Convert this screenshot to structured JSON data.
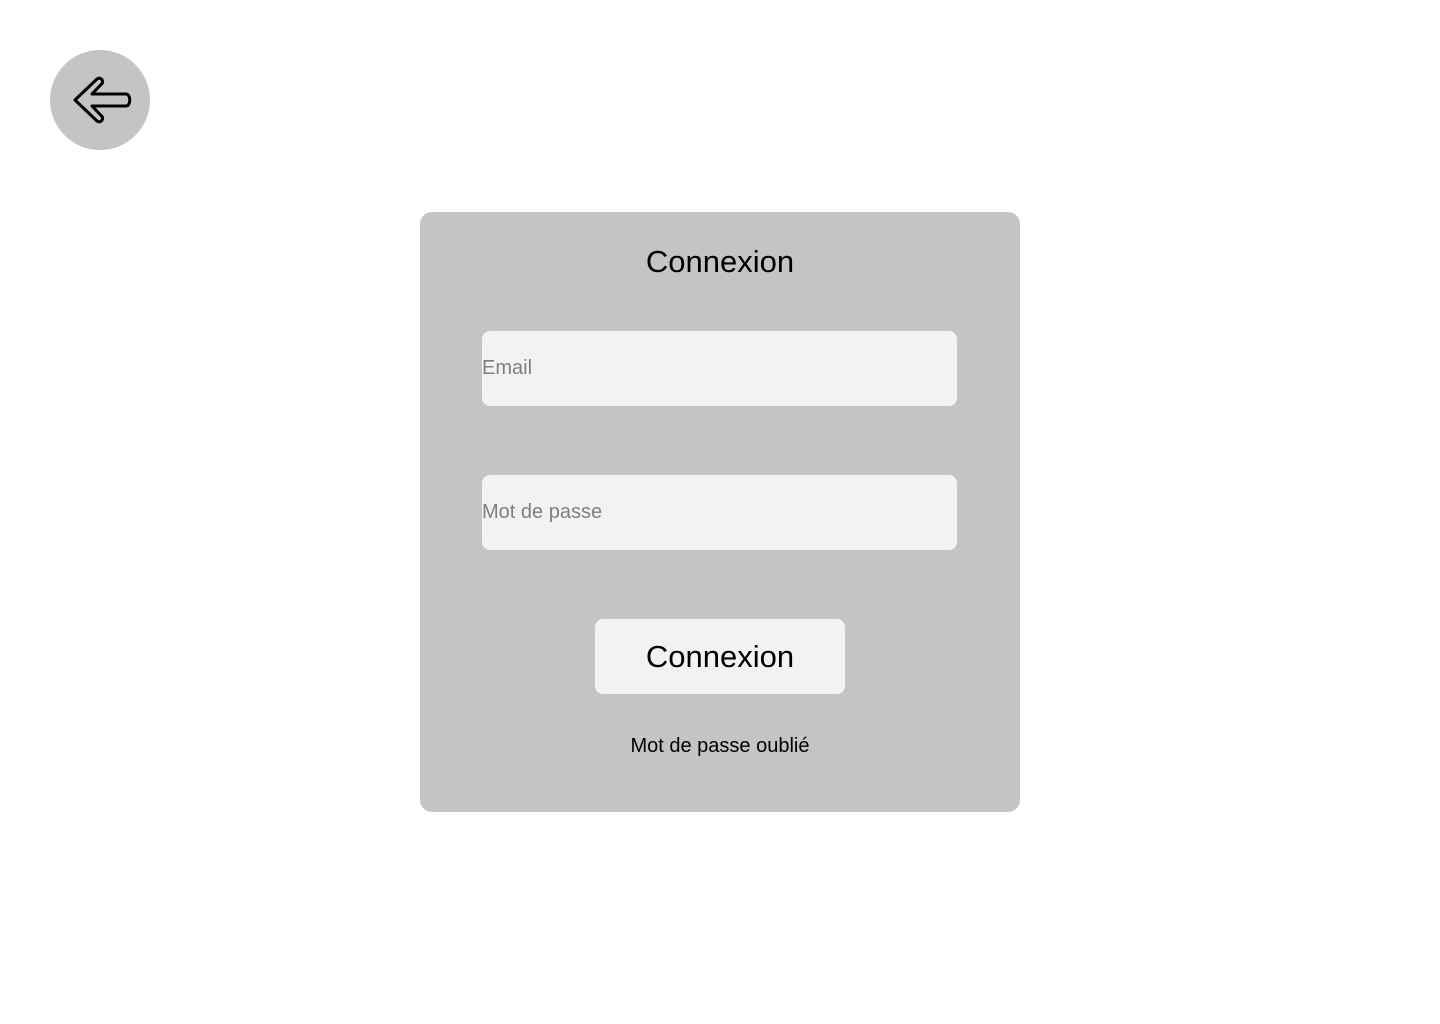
{
  "back_button": {
    "icon": "arrow-left-icon",
    "background": "#c4c4c4"
  },
  "login_card": {
    "title": "Connexion",
    "background": "#c4c4c4",
    "email": {
      "value": "",
      "placeholder": "Email"
    },
    "password": {
      "value": "",
      "placeholder": "Mot de passe"
    },
    "submit_label": "Connexion",
    "forgot_password_label": "Mot de passe oublié"
  },
  "colors": {
    "page_background": "#ffffff",
    "field_background": "#f2f2f2",
    "placeholder_text": "#7f7f7f",
    "text": "#000000"
  }
}
